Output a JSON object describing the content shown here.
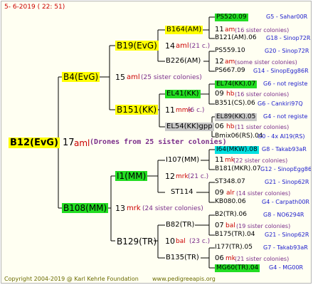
{
  "header": {
    "date": "5-  6-2019 ( 22: 51)"
  },
  "footer": {
    "copyright": "Copyright 2004-2019 @ Karl Kehrle Foundation",
    "site": "www.pedigreeapis.org"
  },
  "root": {
    "name": "B12(EvG)",
    "year": "17",
    "tag": "aml",
    "desc": "(Drones from 25 sister colonies)"
  },
  "gen1": [
    {
      "name": "B4(EvG)",
      "year": "15",
      "tag": "aml",
      "desc": "(25 sister colonies)"
    },
    {
      "name": "B108(MM)",
      "year": "13",
      "tag": "mrk",
      "desc": "(24 sister colonies)"
    }
  ],
  "gen2": [
    {
      "name": "B19(EvG)",
      "year": "14",
      "tag": "aml",
      "desc": "(21 c.)"
    },
    {
      "name": "B151(KK)",
      "year": "11",
      "tag": "mmk",
      "desc": "(6 c.)"
    },
    {
      "name": "I1(MM)",
      "year": "12",
      "tag": "mrk",
      "desc": "(21 c.)"
    },
    {
      "name": "B129(TR)",
      "year": "10",
      "tag": "bal",
      "desc": "(23 c.)"
    }
  ],
  "gen3": [
    {
      "name": "B164(AM)",
      "year": "11",
      "tag": "am",
      "desc": "(16 sister colonies)"
    },
    {
      "name": "B226(AM)",
      "year": "12",
      "tag": "am",
      "desc": "(some sister colonies)"
    },
    {
      "name": "EL41(KK)",
      "year": "09",
      "tag": "hb",
      "desc": "(16 sister colonies)"
    },
    {
      "name": "EL54(KK)gpp",
      "year": "06",
      "tag": "hb",
      "desc": "(11 sister colonies)"
    },
    {
      "name": "I107(MM)",
      "year": "11",
      "tag": "mk",
      "desc": "(22 sister colonies)"
    },
    {
      "name": "ST114",
      "year": "09",
      "tag": "alr",
      "desc": "(14 sister colonies)"
    },
    {
      "name": "B82(TR)",
      "year": "07",
      "tag": "bal",
      "desc": "(19 sister colonies)"
    },
    {
      "name": "B135(TR)",
      "year": "06",
      "tag": "mk",
      "desc": "(21 sister colonies)"
    }
  ],
  "gen4": [
    {
      "name": "PS520.09",
      "ref": "G5 - Sahar00R"
    },
    {
      "name": "B121(AM).06",
      "ref": "G18 - Sinop72R"
    },
    {
      "name": "PS559.10",
      "ref": "G20 - Sinop72R"
    },
    {
      "name": "PS667.09",
      "ref": "G14 - SinopEgg86R"
    },
    {
      "name": "EL74(KK).07",
      "ref": "G6 - not registe"
    },
    {
      "name": "B351(CS).06",
      "ref": "G6 - Cankiri97Q"
    },
    {
      "name": "EL89(KK).05",
      "ref": "G4 - not registe"
    },
    {
      "name": "Bmix06(RS).04",
      "ref": "G0 - 4x AI19(RS)"
    },
    {
      "name": "I64(MKW).08",
      "ref": "G8 - Takab93aR"
    },
    {
      "name": "B181(MKR).07",
      "ref": "G12 - SinopEgg86R"
    },
    {
      "name": "ST348.07",
      "ref": "G21 - Sinop62R"
    },
    {
      "name": "KB080.06",
      "ref": "G4 - Carpath00R"
    },
    {
      "name": "B2(TR).06",
      "ref": "G8 - NO6294R"
    },
    {
      "name": "B175(TR).04",
      "ref": "G21 - Sinop62R"
    },
    {
      "name": "I177(TR).05",
      "ref": "G7 - Takab93aR"
    },
    {
      "name": "MG60(TR).04",
      "ref": "G4 - MG00R"
    }
  ]
}
